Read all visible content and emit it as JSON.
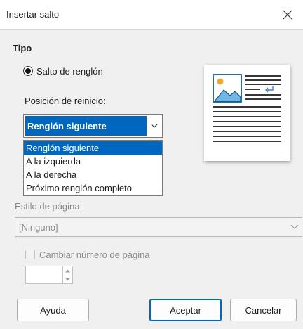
{
  "dialog": {
    "title": "Insertar salto",
    "section_heading": "Tipo",
    "radio_label": "Salto de renglón",
    "position_label": "Posición de reinicio:",
    "position_value": "Renglón siguiente",
    "position_options": [
      "Renglón siguiente",
      "A la izquierda",
      "A la derecha",
      "Próximo renglón completo"
    ],
    "page_style_label": "Estilo de página:",
    "page_style_value": "[Ninguno]",
    "change_page_number_label": "Cambiar número de página"
  },
  "buttons": {
    "help": "Ayuda",
    "ok": "Aceptar",
    "cancel": "Cancelar"
  },
  "colors": {
    "accent": "#0067c0",
    "dialog_bg": "#f0f0f0",
    "disabled_text": "#8c8c8c"
  },
  "icons": {
    "close": "close-icon",
    "dropdown": "chevron-down-icon",
    "preview_image": "image-icon"
  }
}
